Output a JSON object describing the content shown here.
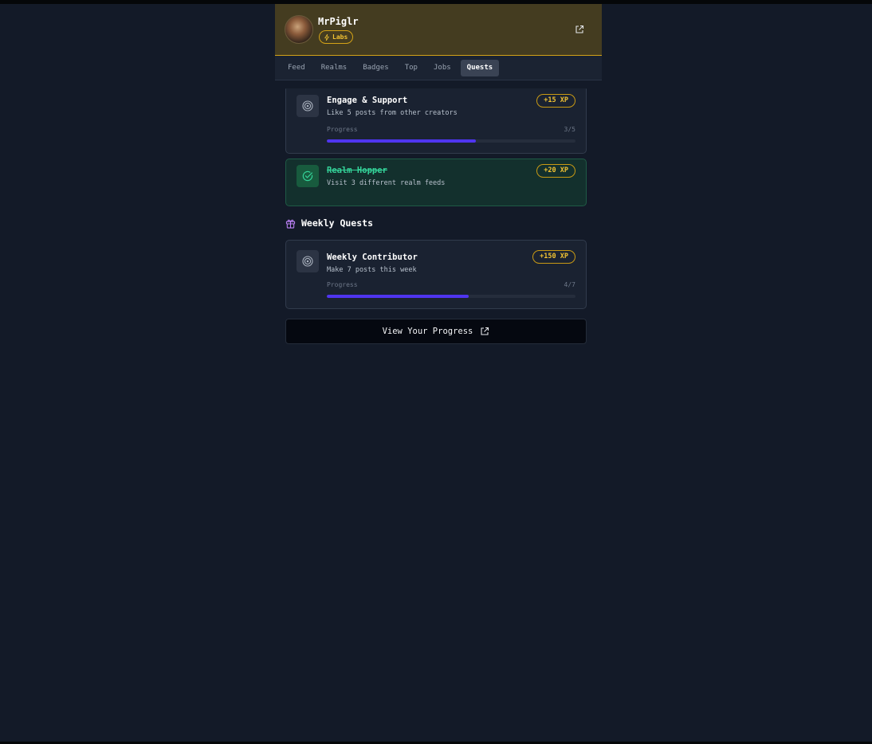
{
  "header": {
    "username": "MrPiglr",
    "badge_label": "Labs",
    "accent_color": "#d4a317",
    "avatar_icon": "avatar-photo",
    "action_icon": "external-link-icon"
  },
  "tabs": [
    {
      "label": "Feed",
      "active": false
    },
    {
      "label": "Realms",
      "active": false
    },
    {
      "label": "Badges",
      "active": false
    },
    {
      "label": "Top",
      "active": false
    },
    {
      "label": "Jobs",
      "active": false
    },
    {
      "label": "Quests",
      "active": true
    }
  ],
  "daily_quests": [
    {
      "title": "Engage & Support",
      "description": "Like 5 posts from other creators",
      "xp": "+15 XP",
      "progress_label": "Progress",
      "progress_text": "3/5",
      "progress_fraction": 0.6,
      "completed": false,
      "icon": "target-icon"
    },
    {
      "title": "Realm Hopper",
      "description": "Visit 3 different realm feeds",
      "xp": "+20 XP",
      "completed": true,
      "icon": "check-circle-icon"
    }
  ],
  "weekly_section": {
    "title": "Weekly Quests",
    "icon": "gift-icon",
    "icon_color": "#c084fc"
  },
  "weekly_quests": [
    {
      "title": "Weekly Contributor",
      "description": "Make 7 posts this week",
      "xp": "+150 XP",
      "progress_label": "Progress",
      "progress_text": "4/7",
      "progress_fraction": 0.571,
      "completed": false,
      "icon": "target-icon"
    }
  ],
  "footer": {
    "view_progress_label": "View Your Progress",
    "icon": "external-link-icon"
  },
  "colors": {
    "progress_fill": "#4f35f0",
    "xp_badge": "#f1c232",
    "completed_text": "#34d399"
  }
}
